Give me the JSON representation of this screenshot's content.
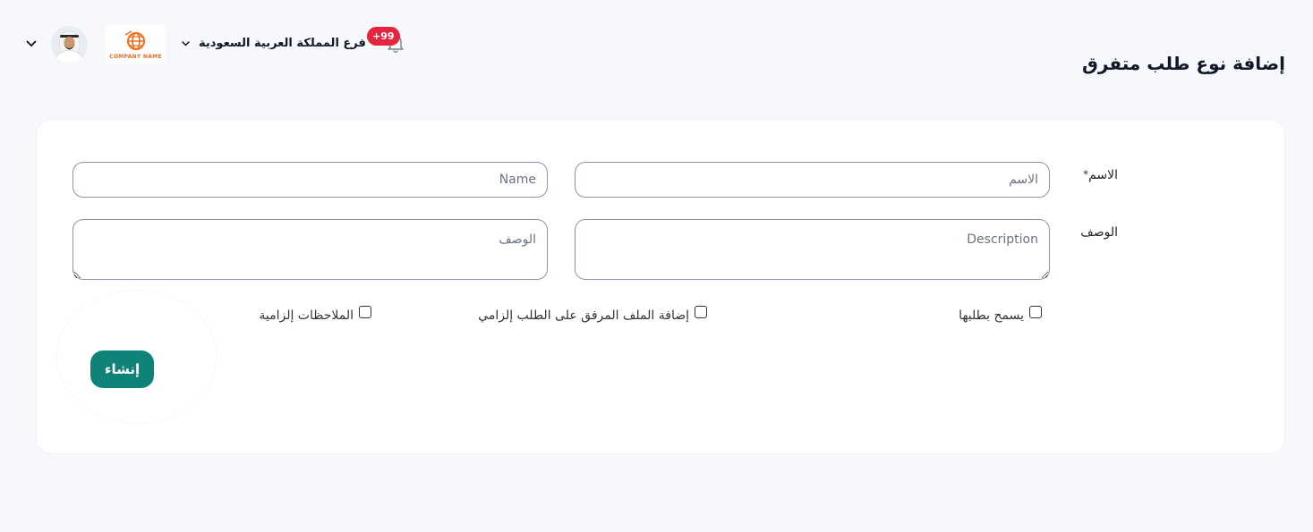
{
  "header": {
    "page_title": "إضافة نوع طلب متفرق",
    "branch_name": "فرع المملكة العربية السعودية",
    "notification_badge": "+99",
    "company_logo_text": "COMPANY NAME"
  },
  "form": {
    "name_label": "الاسم",
    "required_mark": "*",
    "name_ar_placeholder": "الاسم",
    "name_en_placeholder": "Name",
    "description_label": "الوصف",
    "description_en_placeholder": "Description",
    "description_ar_placeholder": "الوصف",
    "checkboxes": [
      {
        "label": "يسمح بطلبها",
        "checked": false
      },
      {
        "label": "إضافة الملف المرفق على الطلب إلزامي",
        "checked": false
      },
      {
        "label": "الملاحظات إلزامية",
        "checked": false
      }
    ],
    "submit_label": "إنشاء"
  },
  "colors": {
    "primary": "#0f8378",
    "badge": "#e3263d",
    "logo": "#f26b1d",
    "background": "#f7f8fc"
  }
}
